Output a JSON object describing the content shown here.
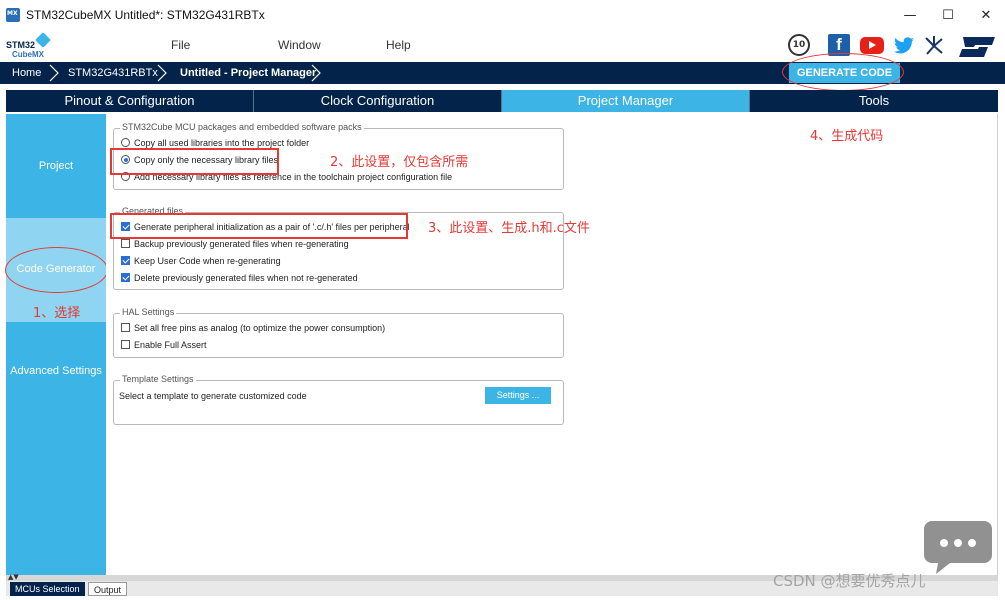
{
  "window": {
    "title": "STM32CubeMX Untitled*: STM32G431RBTx",
    "controls": {
      "minimize": "—",
      "maximize": "☐",
      "close": "✕"
    }
  },
  "logo": {
    "line1": "STM32",
    "line2": "CubeMX"
  },
  "menu": {
    "file": "File",
    "window": "Window",
    "help": "Help"
  },
  "social": {
    "anniversary": "10",
    "facebook": "f",
    "twitter": "🐦",
    "network": "⋇",
    "st": "ST"
  },
  "breadcrumb": {
    "home": "Home",
    "device": "STM32G431RBTx",
    "current": "Untitled - Project Manager"
  },
  "generate_button": "GENERATE CODE",
  "tabs": [
    {
      "label": "Pinout & Configuration",
      "active": false
    },
    {
      "label": "Clock Configuration",
      "active": false
    },
    {
      "label": "Project Manager",
      "active": true
    },
    {
      "label": "Tools",
      "active": false
    }
  ],
  "left_nav": {
    "project": "Project",
    "code_generator": "Code Generator",
    "advanced_settings": "Advanced Settings"
  },
  "packages_group": {
    "title": "STM32Cube MCU packages and embedded software packs",
    "options": [
      {
        "label": "Copy all used libraries into the project folder",
        "selected": false
      },
      {
        "label": "Copy only the necessary library files",
        "selected": true
      },
      {
        "label": "Add necessary library files as reference in the toolchain project configuration file",
        "selected": false
      }
    ]
  },
  "generated_files_group": {
    "title": "Generated files",
    "options": [
      {
        "label": "Generate peripheral initialization as a pair of '.c/.h' files per peripheral",
        "checked": true
      },
      {
        "label": "Backup previously generated files when re-generating",
        "checked": false
      },
      {
        "label": "Keep User Code when re-generating",
        "checked": true
      },
      {
        "label": "Delete previously generated files when not re-generated",
        "checked": true
      }
    ]
  },
  "hal_group": {
    "title": "HAL Settings",
    "options": [
      {
        "label": "Set all free pins as analog (to optimize the power consumption)",
        "checked": false
      },
      {
        "label": "Enable Full Assert",
        "checked": false
      }
    ]
  },
  "template_group": {
    "title": "Template Settings",
    "description": "Select a template to generate customized code",
    "button": "Settings ..."
  },
  "annotations": {
    "step1": "1、选择",
    "step2": "2、此设置，仅包含所需",
    "step3": "3、此设置、生成.h和.c文件",
    "step4": "4、生成代码"
  },
  "bottom_tabs": {
    "mcus_selection": "MCUs Selection",
    "output": "Output"
  },
  "watermark": "CSDN @想要优秀点儿",
  "colors": {
    "navy": "#03234b",
    "accent": "#3cb4e5",
    "annotation": "#e53935"
  }
}
